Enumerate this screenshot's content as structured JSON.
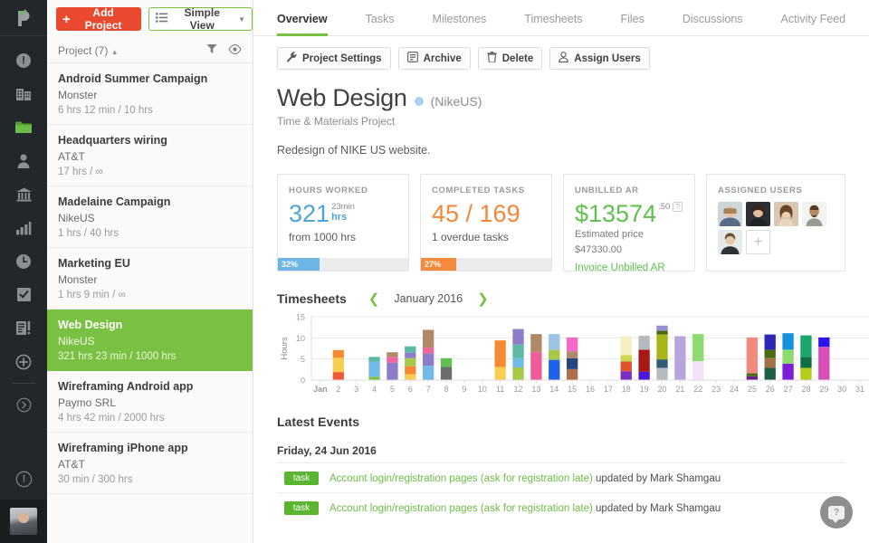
{
  "rail": {
    "logo_name": "paymo-logo",
    "items": [
      {
        "name": "dashboard-icon",
        "label": "Dashboard"
      },
      {
        "name": "company-icon",
        "label": "Company"
      },
      {
        "name": "projects-icon",
        "label": "Projects"
      },
      {
        "name": "clients-icon",
        "label": "Clients"
      },
      {
        "name": "accounting-icon",
        "label": "Accounting"
      },
      {
        "name": "reports-icon",
        "label": "Reports"
      },
      {
        "name": "timesheets-icon",
        "label": "Timesheets"
      },
      {
        "name": "tasks-icon",
        "label": "Tasks"
      },
      {
        "name": "invoices-icon",
        "label": "Invoices"
      },
      {
        "name": "add-icon",
        "label": "Add"
      }
    ],
    "expand_label": "Expand",
    "timer_label": "Timer",
    "avatar_label": "User avatar"
  },
  "projects_panel": {
    "add_button": "Add Project",
    "view_button": "Simple View",
    "header_label": "Project (7)",
    "filter_icon": "filter-icon",
    "eye_icon": "eye-icon",
    "items": [
      {
        "name": "Android Summer Campaign",
        "client": "Monster",
        "hours": "6 hrs 12 min / 10 hrs",
        "active": false
      },
      {
        "name": "Headquarters wiring",
        "client": "AT&T",
        "hours": "17 hrs / ∞",
        "active": false
      },
      {
        "name": "Madelaine Campaign",
        "client": "NikeUS",
        "hours": "1 hrs / 40 hrs",
        "active": false
      },
      {
        "name": "Marketing EU",
        "client": "Monster",
        "hours": "1 hrs 9 min / ∞",
        "active": false
      },
      {
        "name": "Web Design",
        "client": "NikeUS",
        "hours": "321 hrs 23 min / 1000 hrs",
        "active": true
      },
      {
        "name": "Wireframing Android app",
        "client": "Paymo SRL",
        "hours": "4 hrs 42 min / 2000 hrs",
        "active": false
      },
      {
        "name": "Wireframing iPhone app",
        "client": "AT&T",
        "hours": "30 min / 300 hrs",
        "active": false
      }
    ]
  },
  "tabs": [
    {
      "label": "Overview",
      "active": true
    },
    {
      "label": "Tasks",
      "active": false
    },
    {
      "label": "Milestones",
      "active": false
    },
    {
      "label": "Timesheets",
      "active": false
    },
    {
      "label": "Files",
      "active": false
    },
    {
      "label": "Discussions",
      "active": false
    },
    {
      "label": "Activity Feed",
      "active": false
    }
  ],
  "actions": [
    {
      "label": "Project Settings",
      "icon": "wrench-icon"
    },
    {
      "label": "Archive",
      "icon": "archive-icon"
    },
    {
      "label": "Delete",
      "icon": "trash-icon"
    },
    {
      "label": "Assign Users",
      "icon": "user-icon"
    }
  ],
  "project": {
    "title": "Web Design",
    "client": "(NikeUS)",
    "type": "Time & Materials Project",
    "description": "Redesign of NIKE US website.",
    "status_color": "#a9d3ec"
  },
  "cards": {
    "hours_worked": {
      "heading": "HOURS WORKED",
      "value": "321",
      "sup_minutes": "23min",
      "sup_unit": "hrs",
      "sub": "from 1000 hrs",
      "progress_pct": "32%",
      "progress_value": 32,
      "color": "#4fa3dd",
      "bar_color": "#6bb6e4"
    },
    "completed_tasks": {
      "heading": "COMPLETED TASKS",
      "value": "45 / 169",
      "sub": "1 overdue tasks",
      "progress_pct": "27%",
      "progress_value": 27,
      "color": "#f5873b",
      "bar_color": "#f5893c"
    },
    "unbilled_ar": {
      "heading": "UNBILLED AR",
      "value": "$13574",
      "cents": ".50",
      "help": "?",
      "sub_line1": "Estimated price",
      "sub_line2": "$47330.00",
      "link": "Invoice Unbilled AR",
      "color": "#5fc14e"
    },
    "assigned_users": {
      "heading": "ASSIGNED USERS",
      "count": 5,
      "add_label": "+"
    }
  },
  "timesheets": {
    "title": "Timesheets",
    "month": "January 2016",
    "prev_icon": "chevron-left-icon",
    "next_icon": "chevron-right-icon"
  },
  "chart_data": {
    "type": "bar",
    "title": "Timesheets",
    "xlabel": "",
    "ylabel": "Hours",
    "ylim": [
      0,
      15
    ],
    "yticks": [
      0,
      5,
      10,
      15
    ],
    "grid": true,
    "stacked": true,
    "legend": "none",
    "categories": [
      "Jan",
      "2",
      "3",
      "4",
      "5",
      "6",
      "7",
      "8",
      "9",
      "10",
      "11",
      "12",
      "13",
      "14",
      "15",
      "16",
      "17",
      "18",
      "19",
      "20",
      "21",
      "22",
      "23",
      "24",
      "25",
      "26",
      "27",
      "28",
      "29",
      "30",
      "31"
    ],
    "totals": [
      0,
      7.1,
      0,
      5.5,
      6.6,
      8.0,
      11.9,
      5.2,
      0,
      0,
      9.4,
      12.1,
      10.9,
      10.9,
      10.1,
      0,
      0,
      10.4,
      10.5,
      12.9,
      10.4,
      10.9,
      0,
      0,
      10.1,
      10.8,
      11.1,
      10.6,
      10.1,
      0,
      0
    ],
    "bars": [
      {
        "day": "Jan",
        "segments": []
      },
      {
        "day": "2",
        "segments": [
          {
            "value": 1.9,
            "color": "#ef5a3a"
          },
          {
            "value": 3.4,
            "color": "#f7ce4f"
          },
          {
            "value": 1.8,
            "color": "#f58a33"
          }
        ]
      },
      {
        "day": "3",
        "segments": []
      },
      {
        "day": "4",
        "segments": [
          {
            "value": 0.8,
            "color": "#7ac143"
          },
          {
            "value": 3.6,
            "color": "#72bbe8"
          },
          {
            "value": 1.1,
            "color": "#5cb9a4"
          }
        ]
      },
      {
        "day": "5",
        "segments": [
          {
            "value": 4.1,
            "color": "#8d7cc9"
          },
          {
            "value": 1.4,
            "color": "#f2679b"
          },
          {
            "value": 1.1,
            "color": "#b08968"
          }
        ]
      },
      {
        "day": "6",
        "segments": [
          {
            "value": 1.4,
            "color": "#f7ce4f"
          },
          {
            "value": 1.9,
            "color": "#f58a33"
          },
          {
            "value": 1.9,
            "color": "#a7c94a"
          },
          {
            "value": 1.3,
            "color": "#8d7cc9"
          },
          {
            "value": 1.5,
            "color": "#5cb9a4"
          }
        ]
      },
      {
        "day": "7",
        "segments": [
          {
            "value": 3.4,
            "color": "#72bbe8"
          },
          {
            "value": 2.9,
            "color": "#8d7cc9"
          },
          {
            "value": 1.4,
            "color": "#f2679b"
          },
          {
            "value": 4.2,
            "color": "#b08968"
          }
        ]
      },
      {
        "day": "8",
        "segments": [
          {
            "value": 3.1,
            "color": "#6d6d6d"
          },
          {
            "value": 2.1,
            "color": "#5fc14e"
          }
        ]
      },
      {
        "day": "9",
        "segments": []
      },
      {
        "day": "10",
        "segments": []
      },
      {
        "day": "11",
        "segments": [
          {
            "value": 3.1,
            "color": "#f7ce4f"
          },
          {
            "value": 6.3,
            "color": "#f58a33"
          }
        ]
      },
      {
        "day": "12",
        "segments": [
          {
            "value": 3.0,
            "color": "#a7c94a"
          },
          {
            "value": 2.2,
            "color": "#72bbe8"
          },
          {
            "value": 3.2,
            "color": "#5cb9a4"
          },
          {
            "value": 3.7,
            "color": "#8d7cc9"
          }
        ]
      },
      {
        "day": "13",
        "segments": [
          {
            "value": 6.6,
            "color": "#ee5d9b"
          },
          {
            "value": 4.3,
            "color": "#b08968"
          }
        ]
      },
      {
        "day": "14",
        "segments": [
          {
            "value": 4.8,
            "color": "#1f62e8"
          },
          {
            "value": 2.4,
            "color": "#a7c94a"
          },
          {
            "value": 3.7,
            "color": "#9dc3e8"
          }
        ]
      },
      {
        "day": "15",
        "segments": [
          {
            "value": 2.6,
            "color": "#b0704a"
          },
          {
            "value": 2.6,
            "color": "#29457f"
          },
          {
            "value": 1.6,
            "color": "#b08968"
          },
          {
            "value": 3.3,
            "color": "#f569c8"
          }
        ]
      },
      {
        "day": "16",
        "segments": []
      },
      {
        "day": "17",
        "segments": []
      },
      {
        "day": "18",
        "segments": [
          {
            "value": 2.1,
            "color": "#7a2fc4"
          },
          {
            "value": 2.3,
            "color": "#e2532b"
          },
          {
            "value": 1.5,
            "color": "#cbd84e"
          },
          {
            "value": 4.5,
            "color": "#f6f0c0"
          }
        ]
      },
      {
        "day": "19",
        "segments": [
          {
            "value": 2.0,
            "color": "#4b16e0"
          },
          {
            "value": 5.2,
            "color": "#a81818"
          },
          {
            "value": 3.3,
            "color": "#b3b9bd"
          }
        ]
      },
      {
        "day": "20",
        "segments": [
          {
            "value": 2.9,
            "color": "#b5bcc0"
          },
          {
            "value": 2.0,
            "color": "#2f5c72"
          },
          {
            "value": 5.9,
            "color": "#a8b518"
          },
          {
            "value": 0.9,
            "color": "#4a6b13"
          },
          {
            "value": 1.2,
            "color": "#9a8fd4"
          }
        ]
      },
      {
        "day": "21",
        "segments": [
          {
            "value": 10.4,
            "color": "#b7a6de"
          }
        ]
      },
      {
        "day": "22",
        "segments": [
          {
            "value": 4.5,
            "color": "#f3e2f5"
          },
          {
            "value": 6.4,
            "color": "#8ddb6e"
          }
        ]
      },
      {
        "day": "23",
        "segments": []
      },
      {
        "day": "24",
        "segments": []
      },
      {
        "day": "25",
        "segments": [
          {
            "value": 0.9,
            "color": "#6b1f8f"
          },
          {
            "value": 0.7,
            "color": "#4a6b13"
          },
          {
            "value": 8.5,
            "color": "#f4897f"
          }
        ]
      },
      {
        "day": "26",
        "segments": [
          {
            "value": 2.9,
            "color": "#1e5e45"
          },
          {
            "value": 2.3,
            "color": "#a3714a"
          },
          {
            "value": 2.0,
            "color": "#4a6b13"
          },
          {
            "value": 3.6,
            "color": "#2c27b5"
          }
        ]
      },
      {
        "day": "27",
        "segments": [
          {
            "value": 3.9,
            "color": "#7a1fd6"
          },
          {
            "value": 3.3,
            "color": "#8ddb6e"
          },
          {
            "value": 3.9,
            "color": "#1591e0"
          }
        ]
      },
      {
        "day": "28",
        "segments": [
          {
            "value": 2.9,
            "color": "#b5cc1c"
          },
          {
            "value": 2.6,
            "color": "#0e6e44"
          },
          {
            "value": 5.1,
            "color": "#1aa86a"
          }
        ]
      },
      {
        "day": "29",
        "segments": [
          {
            "value": 7.9,
            "color": "#d84fb5"
          },
          {
            "value": 2.2,
            "color": "#2a15f0"
          }
        ]
      },
      {
        "day": "30",
        "segments": []
      },
      {
        "day": "31",
        "segments": []
      }
    ]
  },
  "latest_events": {
    "title": "Latest Events",
    "date": "Friday, 24 Jun 2016",
    "rows": [
      {
        "badge": "task",
        "link": "Account login/registration pages (ask for registration late)",
        "rest": " updated by Mark Shamgau"
      },
      {
        "badge": "task",
        "link": "Account login/registration pages (ask for registration late)",
        "rest": " updated by Mark Shamgau"
      }
    ]
  },
  "help": {
    "label": "?",
    "name": "help-button"
  }
}
